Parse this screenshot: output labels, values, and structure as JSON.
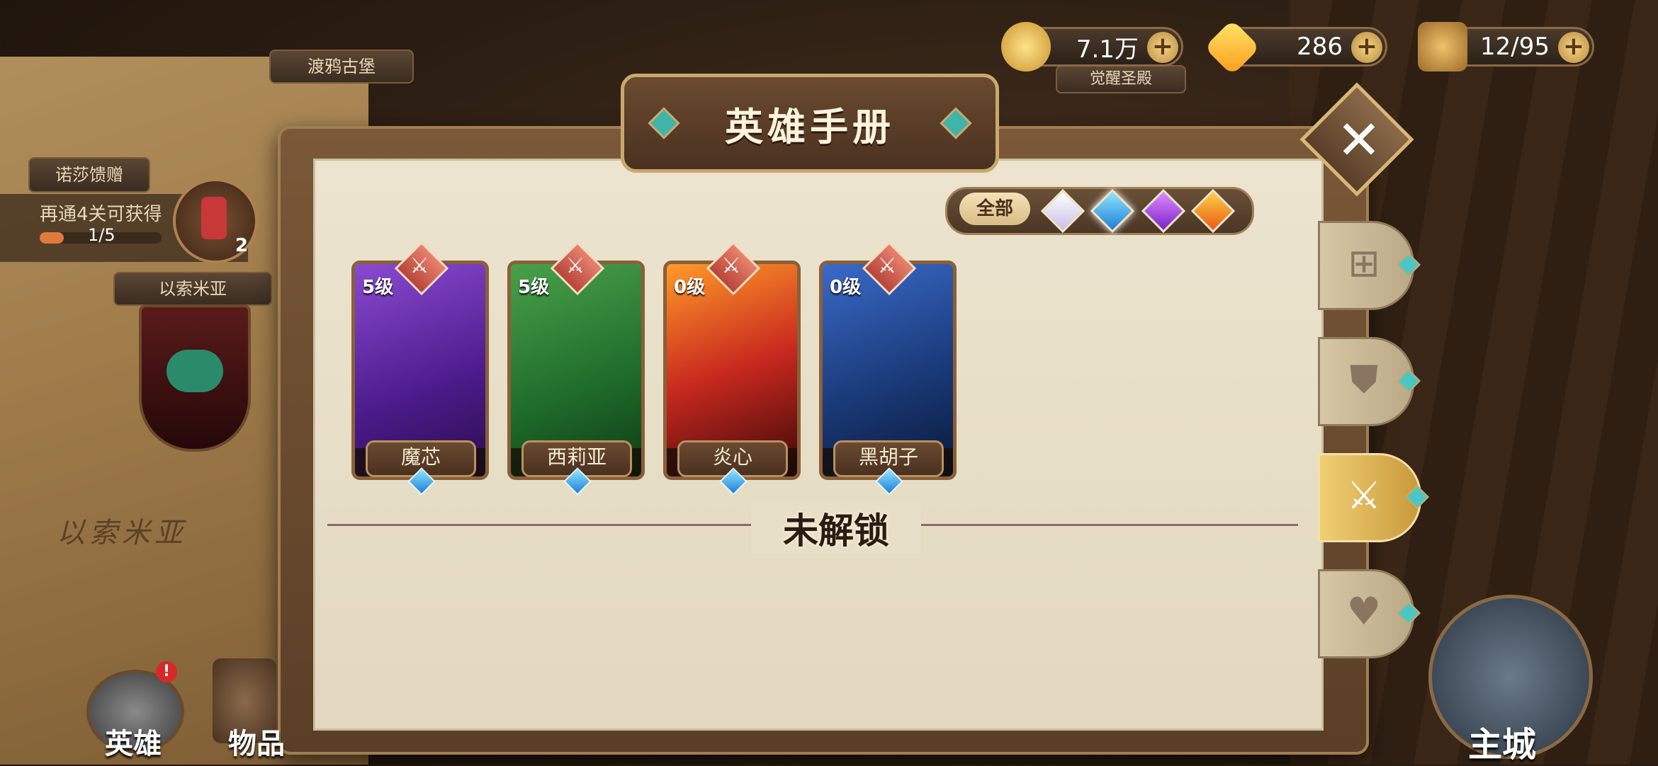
{
  "resources": {
    "gold": "7.1万",
    "gems": "286",
    "stamina": "12/95"
  },
  "map": {
    "location_top": "渡鸦古堡",
    "location_right": "觉醒圣殿",
    "location_left": "以索米亚",
    "region_name": "以索米亚"
  },
  "reward": {
    "tag": "诺莎馈赠",
    "hint": "再通4关可获得",
    "progress": "1/5",
    "progress_fraction": 0.2,
    "count": "2"
  },
  "panel": {
    "title": "英雄手册",
    "filter_all": "全部",
    "locked_label": "未解锁"
  },
  "heroes": [
    {
      "name": "魔芯",
      "level": "5级",
      "stars": "★★★★★"
    },
    {
      "name": "西莉亚",
      "level": "5级",
      "stars": "★★★★"
    },
    {
      "name": "炎心",
      "level": "0级",
      "stars": "★★★★"
    },
    {
      "name": "黑胡子",
      "level": "0级",
      "stars": "★★"
    }
  ],
  "side_tabs": [
    "grid-icon",
    "shield-icon",
    "sword-icon",
    "heart-icon"
  ],
  "bottom_nav": {
    "hero": "英雄",
    "items": "物品",
    "main_city": "主城"
  }
}
